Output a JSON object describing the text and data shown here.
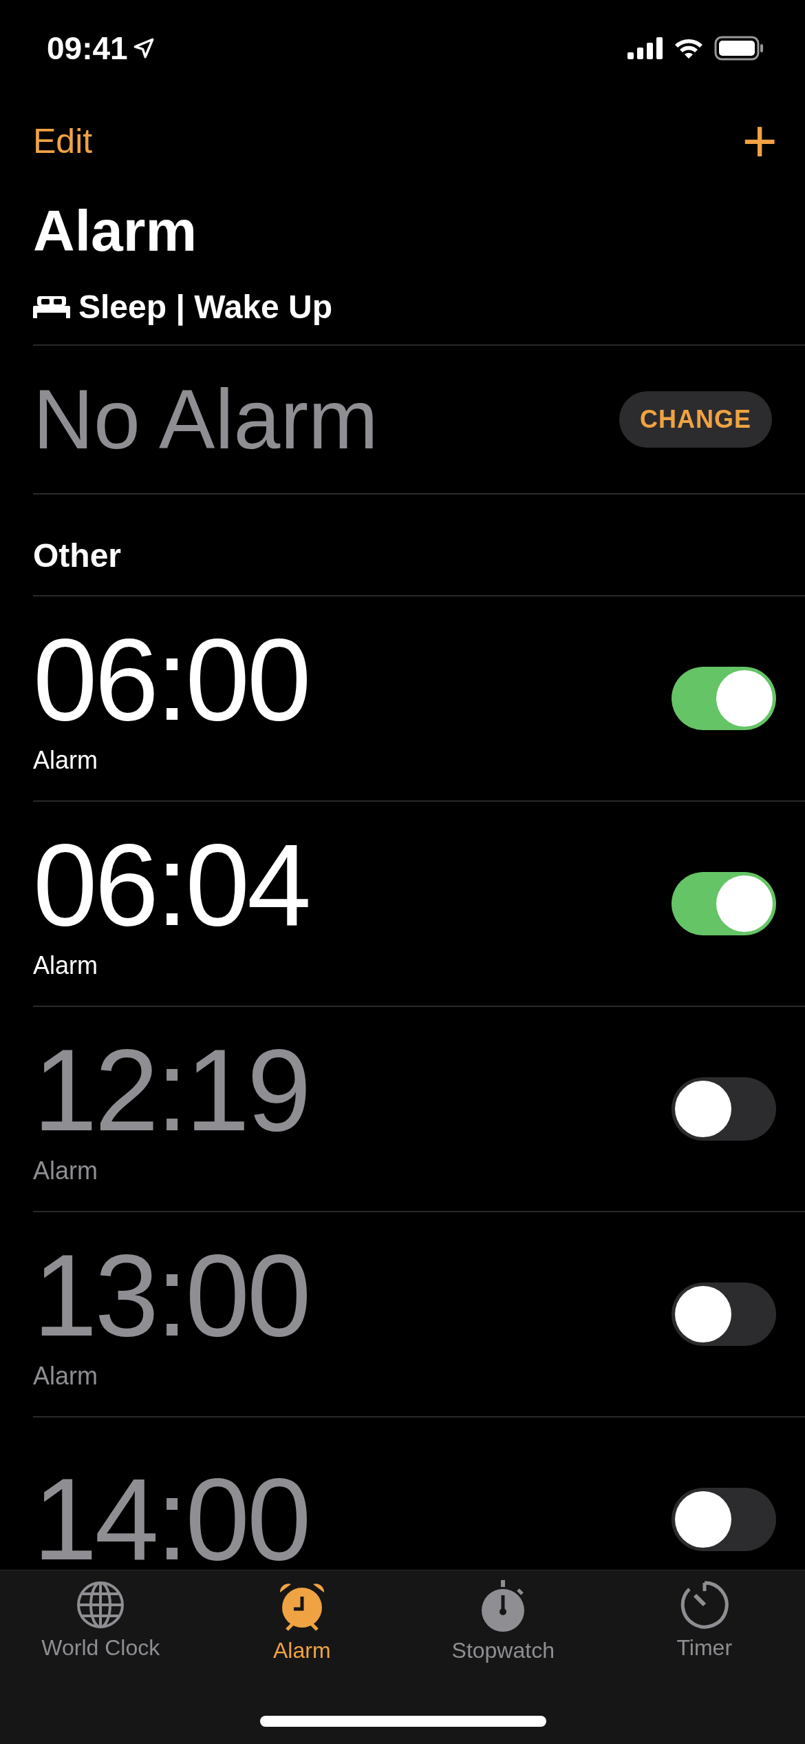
{
  "status_bar": {
    "time": "09:41"
  },
  "nav": {
    "edit": "Edit",
    "add": "+"
  },
  "title": "Alarm",
  "sleep": {
    "heading": "Sleep | Wake Up",
    "value": "No Alarm",
    "button": "CHANGE"
  },
  "section": "Other",
  "alarms": [
    {
      "time": "06:00",
      "label": "Alarm",
      "on": true
    },
    {
      "time": "06:04",
      "label": "Alarm",
      "on": true
    },
    {
      "time": "12:19",
      "label": "Alarm",
      "on": false
    },
    {
      "time": "13:00",
      "label": "Alarm",
      "on": false
    },
    {
      "time": "14:00",
      "on": false
    }
  ],
  "tabs": [
    {
      "kind": "globe",
      "label": "World Clock",
      "selected": false
    },
    {
      "kind": "alarm",
      "label": "Alarm",
      "selected": true
    },
    {
      "kind": "stopwatch",
      "label": "Stopwatch",
      "selected": false
    },
    {
      "kind": "timer",
      "label": "Timer",
      "selected": false
    }
  ]
}
